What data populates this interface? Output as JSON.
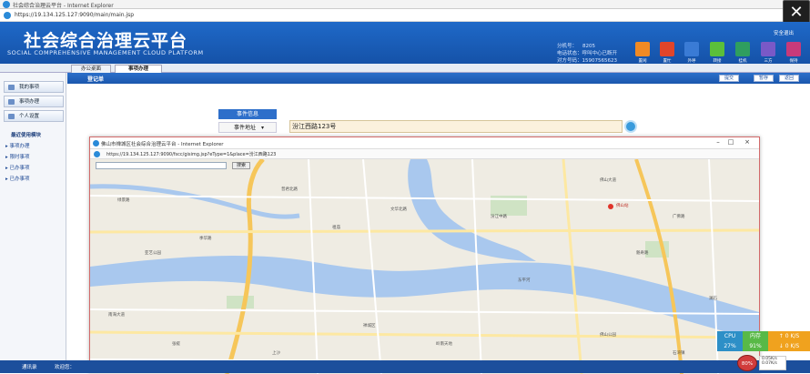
{
  "browser": {
    "title": "社会综合治理云平台 - Internet Explorer",
    "url": "https://19.134.125.127:9090/main/main.jsp"
  },
  "close_label": "✕",
  "header": {
    "title": "社会综合治理云平台",
    "subtitle": "SOCIAL COMPREHENSIVE MANAGEMENT CLOUD PLATFORM",
    "logout": "安全退出",
    "seat_label": "分机号：",
    "seat_value": "8205",
    "phone_label": "电话状态：",
    "phone_value": "呼叫中心已断开",
    "other_label": "对方号码：",
    "other_value": "15907565623",
    "toolbar": [
      {
        "label": "置闲",
        "color": "#f08a24"
      },
      {
        "label": "置忙",
        "color": "#e0452a"
      },
      {
        "label": "外呼",
        "color": "#3a7bd5"
      },
      {
        "label": "转接",
        "color": "#5bbf3a"
      },
      {
        "label": "挂机",
        "color": "#2f9e5f"
      },
      {
        "label": "三方",
        "color": "#7a59c7"
      },
      {
        "label": "保持",
        "color": "#c73a7a"
      }
    ]
  },
  "tabs": [
    {
      "label": "办公桌面"
    },
    {
      "label": "事项办理"
    }
  ],
  "sidebar": {
    "buttons": [
      {
        "label": "我的事项"
      },
      {
        "label": "事项办理"
      },
      {
        "label": "个人设置"
      }
    ],
    "recent_title": "最近使用模块",
    "links": [
      {
        "label": "事项办理"
      },
      {
        "label": "限时事项"
      },
      {
        "label": "已办事项"
      },
      {
        "label": "已办事项"
      }
    ]
  },
  "form": {
    "crumb": "登记单",
    "submit": "提交",
    "save": "暂存",
    "back": "返回",
    "event_tab": "事件信息",
    "address_label": "事件地址",
    "address_value": "汾江西路123号"
  },
  "popup": {
    "title": "佛山市禅城区社会综合治理云平台 - Internet Explorer",
    "url": "https://19.134.125.127:9090/fscc/gisimg.jsp?eType=1&place=汾江西路123",
    "search_placeholder": "",
    "search_button": "搜索",
    "map_labels": [
      "绿景路",
      "季华路",
      "祖庙",
      "文华北路",
      "佛山大道",
      "汾江中路",
      "魁奇路",
      "东平河",
      "亚艺公园",
      "佛山站",
      "普君北路",
      "岭南天地",
      "禅城区",
      "南海大道",
      "广佛路",
      "佛山公园",
      "上沙",
      "石湾镇",
      "张槎",
      "澜石"
    ]
  },
  "status": {
    "taskbar_left": "通讯录",
    "taskbar_welcome": "欢迎您：",
    "cpu_label": "CPU",
    "cpu_value": "27%",
    "mem_label": "内存",
    "mem_value": "91%",
    "net_up": "0 K/S",
    "net_down": "0 K/S",
    "ball": "80%",
    "net_small_up": "0.05K/s",
    "net_small_down": "0.07K/s"
  }
}
